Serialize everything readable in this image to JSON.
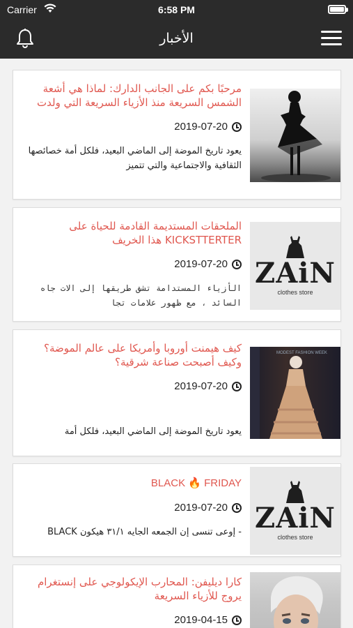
{
  "status": {
    "carrier": "Carrier",
    "time": "6:58 PM"
  },
  "nav": {
    "title": "الأخبار"
  },
  "articles": [
    {
      "title": "مرحبًا بكم على الجانب الدارك: لماذا هي أشعة الشمس السريعة منذ الأزياء السريعة التي ولدت",
      "date": "2019-07-20",
      "excerpt": "يعود تاريخ الموضة إلى الماضي البعيد، فلكل أمة خصائصها الثقافية والاجتماعية والتي تتميز",
      "image": "silhouette-dress-photo"
    },
    {
      "title": "الملحقات المستديمة القادمة للحياة على KICKSTTERTER هذا الخريف",
      "date": "2019-07-20",
      "excerpt": "الأزياء المستدامة تشق طريقها إلى الات جاه السائد ، مع ظهور علامات تجا",
      "image": "zain-logo",
      "brand": "ZAiN",
      "brand_sub": "clothes store"
    },
    {
      "title": "كيف هيمنت أوروبا وأمريكا على عالم الموضة؟ وكيف أصبحت صناعة شرقية؟",
      "date": "2019-07-20",
      "excerpt": "يعود تاريخ الموضة إلى الماضي البعيد، فلكل أمة",
      "image": "runway-photo",
      "photo_text": "MODEST FASHION WEEK"
    },
    {
      "title": "BLACK 🔥 FRIDAY",
      "date": "2019-07-20",
      "excerpt": "- إوعى تنسى إن الجمعه الجايه ٣١/١ هيكون BLACK",
      "image": "zain-logo",
      "brand": "ZAiN",
      "brand_sub": "clothes store"
    },
    {
      "title": "كارا ديليفن: المحارب الإيكولوجي على إنستغرام يروج للأزياء السريعة",
      "date": "2019-04-15",
      "excerpt": "",
      "image": "portrait-photo"
    }
  ],
  "colors": {
    "navbar": "#2b2b2b",
    "headline": "#e0574f",
    "background": "#f2f2f2"
  }
}
